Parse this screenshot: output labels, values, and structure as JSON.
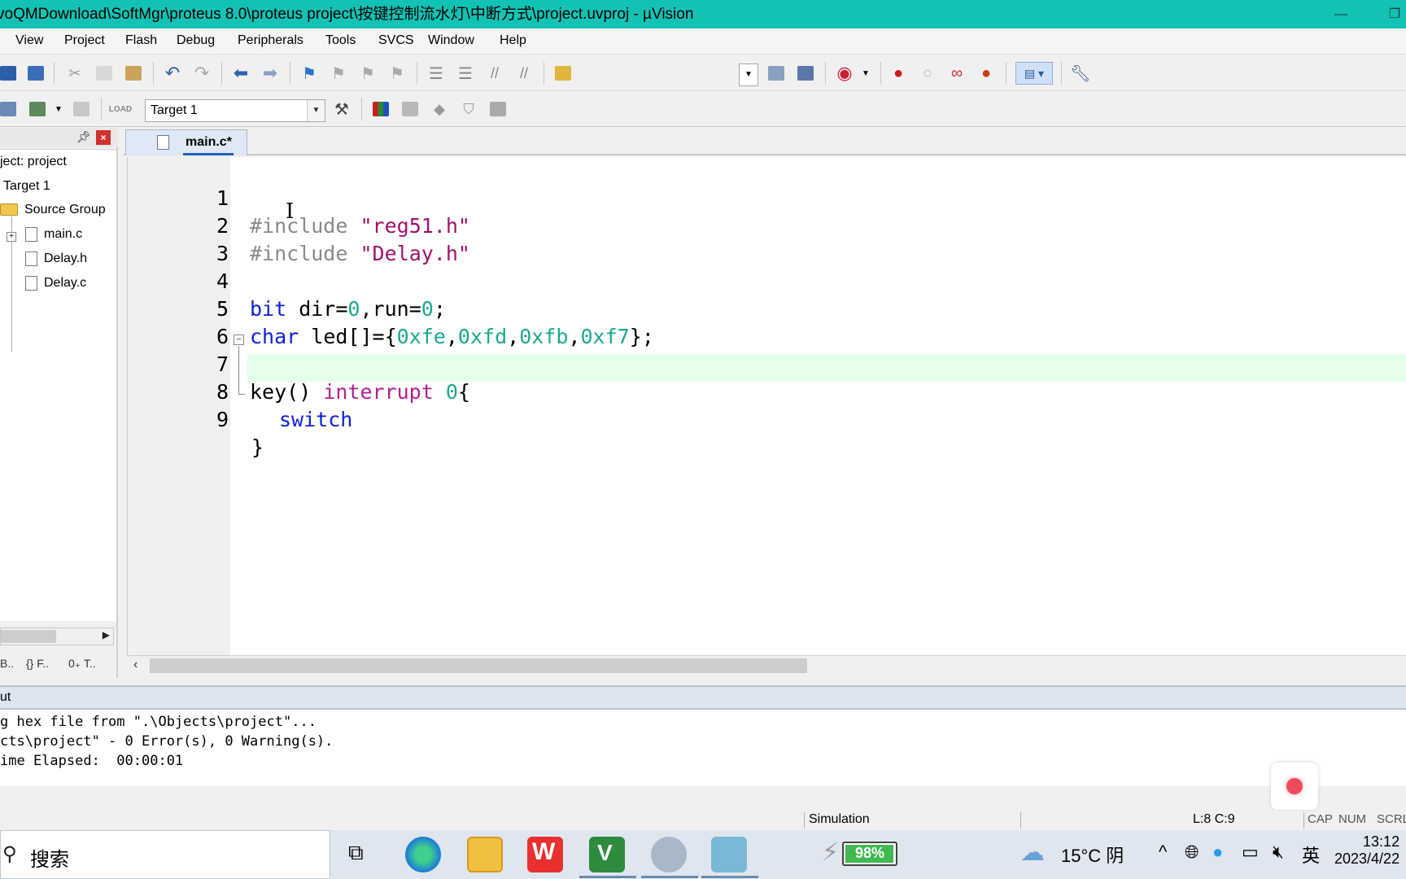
{
  "window": {
    "title": "voQMDownload\\SoftMgr\\proteus 8.0\\proteus project\\按键控制流水灯\\中断方式\\project.uvproj - µVision"
  },
  "menu": {
    "items": [
      "View",
      "Project",
      "Flash",
      "Debug",
      "Peripherals",
      "Tools",
      "SVCS",
      "Window",
      "Help"
    ]
  },
  "toolbar": {
    "target": "Target 1",
    "target_dropdown_icon": "chevron-down-icon"
  },
  "project_panel": {
    "project_label": "ject: project",
    "target_label": "Target 1",
    "group_label": "Source Group",
    "files": [
      "main.c",
      "Delay.h",
      "Delay.c"
    ],
    "tabs": [
      "B..",
      "{} F..",
      "0₊ T.."
    ]
  },
  "editor": {
    "tab_label": "main.c*",
    "lines": [
      {
        "num": "1"
      },
      {
        "num": "2"
      },
      {
        "num": "3"
      },
      {
        "num": "4"
      },
      {
        "num": "5"
      },
      {
        "num": "6"
      },
      {
        "num": "7"
      },
      {
        "num": "8"
      },
      {
        "num": "9"
      }
    ],
    "code": {
      "l1_pre": "#include",
      "l1_str": "\"reg51.h\"",
      "l2_pre": "#include",
      "l2_str": "\"Delay.h\"",
      "l4_kw": "bit",
      "l4_a": " dir=",
      "l4_n1": "0",
      "l4_b": ",run=",
      "l4_n2": "0",
      "l4_c": ";",
      "l5_kw": "char",
      "l5_a": " led[]={",
      "l5_n1": "0xfe",
      "l5_s1": ",",
      "l5_n2": "0xfd",
      "l5_s2": ",",
      "l5_n3": "0xfb",
      "l5_s3": ",",
      "l5_n4": "0xf7",
      "l5_c": "};",
      "l7_a": "key() ",
      "l7_kw": "interrupt",
      "l7_sp": " ",
      "l7_n": "0",
      "l7_c": "{",
      "l8_kw": "switch",
      "l9": "}"
    }
  },
  "output": {
    "title": "ut",
    "lines": [
      "g hex file from \".\\Objects\\project\"...",
      "cts\\project\" - 0 Error(s), 0 Warning(s).",
      "ime Elapsed:  00:00:01"
    ]
  },
  "status": {
    "mode": "Simulation",
    "position": "L:8 C:9",
    "cap": "CAP",
    "num": "NUM",
    "scrl": "SCRL"
  },
  "taskbar": {
    "search_text": "搜索",
    "battery": "98%",
    "battery_level": 0.98,
    "weather": "15°C 阴",
    "ime": "英",
    "time": "13:12",
    "date": "2023/4/22"
  }
}
